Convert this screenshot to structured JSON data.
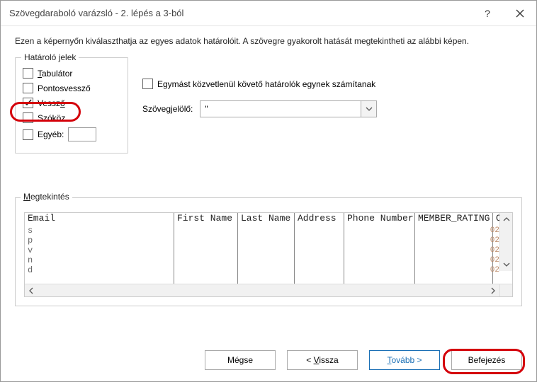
{
  "titlebar": {
    "title": "Szövegdaraboló varázsló - 2. lépés a 3-ból"
  },
  "intro": "Ezen a képernyőn kiválaszthatja az egyes adatok határolóit. A szövegre gyakorolt hatását megtekintheti az alábbi képen.",
  "delimiters": {
    "legend": "Határoló jelek",
    "tab": "Tabulátor",
    "semicolon": "Pontosvessző",
    "comma": "Vessző",
    "space": "Szóköz",
    "other": "Egyéb:",
    "other_value": ""
  },
  "consecutive": "Egymást közvetlenül követő határolók egynek számítanak",
  "qualifier": {
    "label": "Szövegjelölő:",
    "value": "\""
  },
  "preview": {
    "legend": "Megtekintés",
    "columns": [
      "Email",
      "First Name",
      "Last Name",
      "Address",
      "Phone Number",
      "MEMBER_RATING",
      "OPTI"
    ],
    "left_stub": [
      "s",
      "p",
      "v",
      "n",
      "d"
    ],
    "right_stub": [
      "02",
      "02",
      "02",
      "02",
      "02"
    ]
  },
  "buttons": {
    "cancel": "Mégse",
    "back": "< Vissza",
    "next": "Tovább >",
    "finish": "Befejezés"
  }
}
